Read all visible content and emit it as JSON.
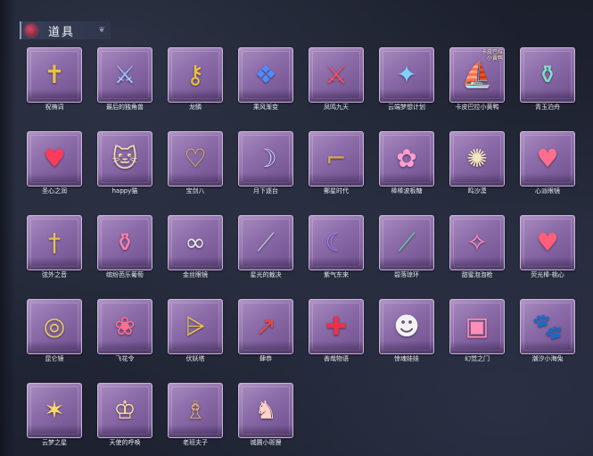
{
  "header": {
    "title": "道具",
    "emblem_icon": "medal-icon"
  },
  "items": [
    {
      "label": "祝祷词",
      "icon": "golden-cross-scepter-icon",
      "glyph": "✝",
      "color": "#e8c14a"
    },
    {
      "label": "最后的独角兽",
      "icon": "unicorn-horn-lance-icon",
      "glyph": "⚔",
      "color": "#9fc8ff"
    },
    {
      "label": "龙鳞",
      "icon": "golden-key-icon",
      "glyph": "⚷",
      "color": "#f2c33a"
    },
    {
      "label": "乘风渐变",
      "icon": "blue-winged-relic-icon",
      "glyph": "❖",
      "color": "#4f8cff"
    },
    {
      "label": "凤鸣九天",
      "icon": "red-phoenix-blade-icon",
      "glyph": "⚔",
      "color": "#ff4f5e"
    },
    {
      "label": "云端梦想计划",
      "icon": "star-wand-icon",
      "glyph": "✦",
      "color": "#7fd0ff"
    },
    {
      "label": "卡皮巴拉小黄鸭",
      "icon": "capybara-ship-icon",
      "glyph": "⛵",
      "color": "#d9a35a",
      "badge": "卡皮巴拉\n小黄鸭"
    },
    {
      "label": "青玉泊舟",
      "icon": "jade-bottle-icon",
      "glyph": "⚱",
      "color": "#7fe0c8"
    },
    {
      "label": "圣心之润",
      "icon": "ruby-heart-scepter-icon",
      "glyph": "♥",
      "color": "#ff3b5c"
    },
    {
      "label": "happy猫",
      "icon": "cat-figurine-icon",
      "glyph": "🐱",
      "color": "#f0d6b0"
    },
    {
      "label": "宝剑八",
      "icon": "golden-heart-frame-icon",
      "glyph": "♡",
      "color": "#f7c948"
    },
    {
      "label": "月下逐台",
      "icon": "moon-mirror-icon",
      "glyph": "☽",
      "color": "#c9d6ff"
    },
    {
      "label": "郵星时代",
      "icon": "golden-revolver-icon",
      "glyph": "⌐",
      "color": "#d9a94a"
    },
    {
      "label": "棒棒波板糖",
      "icon": "pink-candy-wand-icon",
      "glyph": "✿",
      "color": "#ff9ed0"
    },
    {
      "label": "鸣沙漠",
      "icon": "dreamcatcher-icon",
      "glyph": "✺",
      "color": "#f3e6c0"
    },
    {
      "label": "心派眼镜",
      "icon": "heart-glasses-icon",
      "glyph": "♥",
      "color": "#ff6e8f"
    },
    {
      "label": "弦外之音",
      "icon": "golden-sword-icon",
      "glyph": "†",
      "color": "#e7c25a"
    },
    {
      "label": "缤纷芭乐葡萄",
      "icon": "pink-drink-bottle-icon",
      "glyph": "⚱",
      "color": "#ff7fa8"
    },
    {
      "label": "金丝眼镜",
      "icon": "gold-rim-glasses-icon",
      "glyph": "∞",
      "color": "#e6e6e6"
    },
    {
      "label": "星光的裁决",
      "icon": "silver-rifle-icon",
      "glyph": "⟋",
      "color": "#b8c4d8"
    },
    {
      "label": "紫气东来",
      "icon": "purple-curved-blade-icon",
      "glyph": "☾",
      "color": "#a080ff"
    },
    {
      "label": "碧落琼环",
      "icon": "jade-staff-icon",
      "glyph": "⟋",
      "color": "#5fd39a"
    },
    {
      "label": "甜蜜泡泡枪",
      "icon": "pink-bubble-gun-icon",
      "glyph": "✧",
      "color": "#ff8fc8"
    },
    {
      "label": "荧光棒-桃心",
      "icon": "heart-glowstick-icon",
      "glyph": "♥",
      "color": "#ff5f7a"
    },
    {
      "label": "昆仑镜",
      "icon": "kunlun-mirror-icon",
      "glyph": "◎",
      "color": "#e8cf6a"
    },
    {
      "label": "飞花令",
      "icon": "flower-fan-icon",
      "glyph": "❀",
      "color": "#ff6f8f"
    },
    {
      "label": "伏妖塔",
      "icon": "pagoda-tower-icon",
      "glyph": "⩥",
      "color": "#f0c64e"
    },
    {
      "label": "肆恭",
      "icon": "red-spear-icon",
      "glyph": "↗",
      "color": "#e04a4a"
    },
    {
      "label": "善哉物语",
      "icon": "red-medical-case-icon",
      "glyph": "✚",
      "color": "#e8324a"
    },
    {
      "label": "惊魂娃娃",
      "icon": "panda-doll-icon",
      "glyph": "☻",
      "color": "#f2f2f2"
    },
    {
      "label": "幻觉之门",
      "icon": "pink-portal-card-icon",
      "glyph": "▣",
      "color": "#ff8fb8"
    },
    {
      "label": "潮汐小海兔",
      "icon": "blue-cat-plush-icon",
      "glyph": "🐾",
      "color": "#5fb8ff"
    },
    {
      "label": "云梦之星",
      "icon": "unicorn-star-icon",
      "glyph": "✶",
      "color": "#ffd86a"
    },
    {
      "label": "天使的呼唤",
      "icon": "angel-cherub-icon",
      "glyph": "♔",
      "color": "#ffe0a8"
    },
    {
      "label": "老班夫子",
      "icon": "teacher-bear-icon",
      "glyph": "♗",
      "color": "#d9a87a"
    },
    {
      "label": "城圃小斑狸",
      "icon": "fox-spirit-doll-icon",
      "glyph": "♞",
      "color": "#ffd2c8"
    }
  ]
}
